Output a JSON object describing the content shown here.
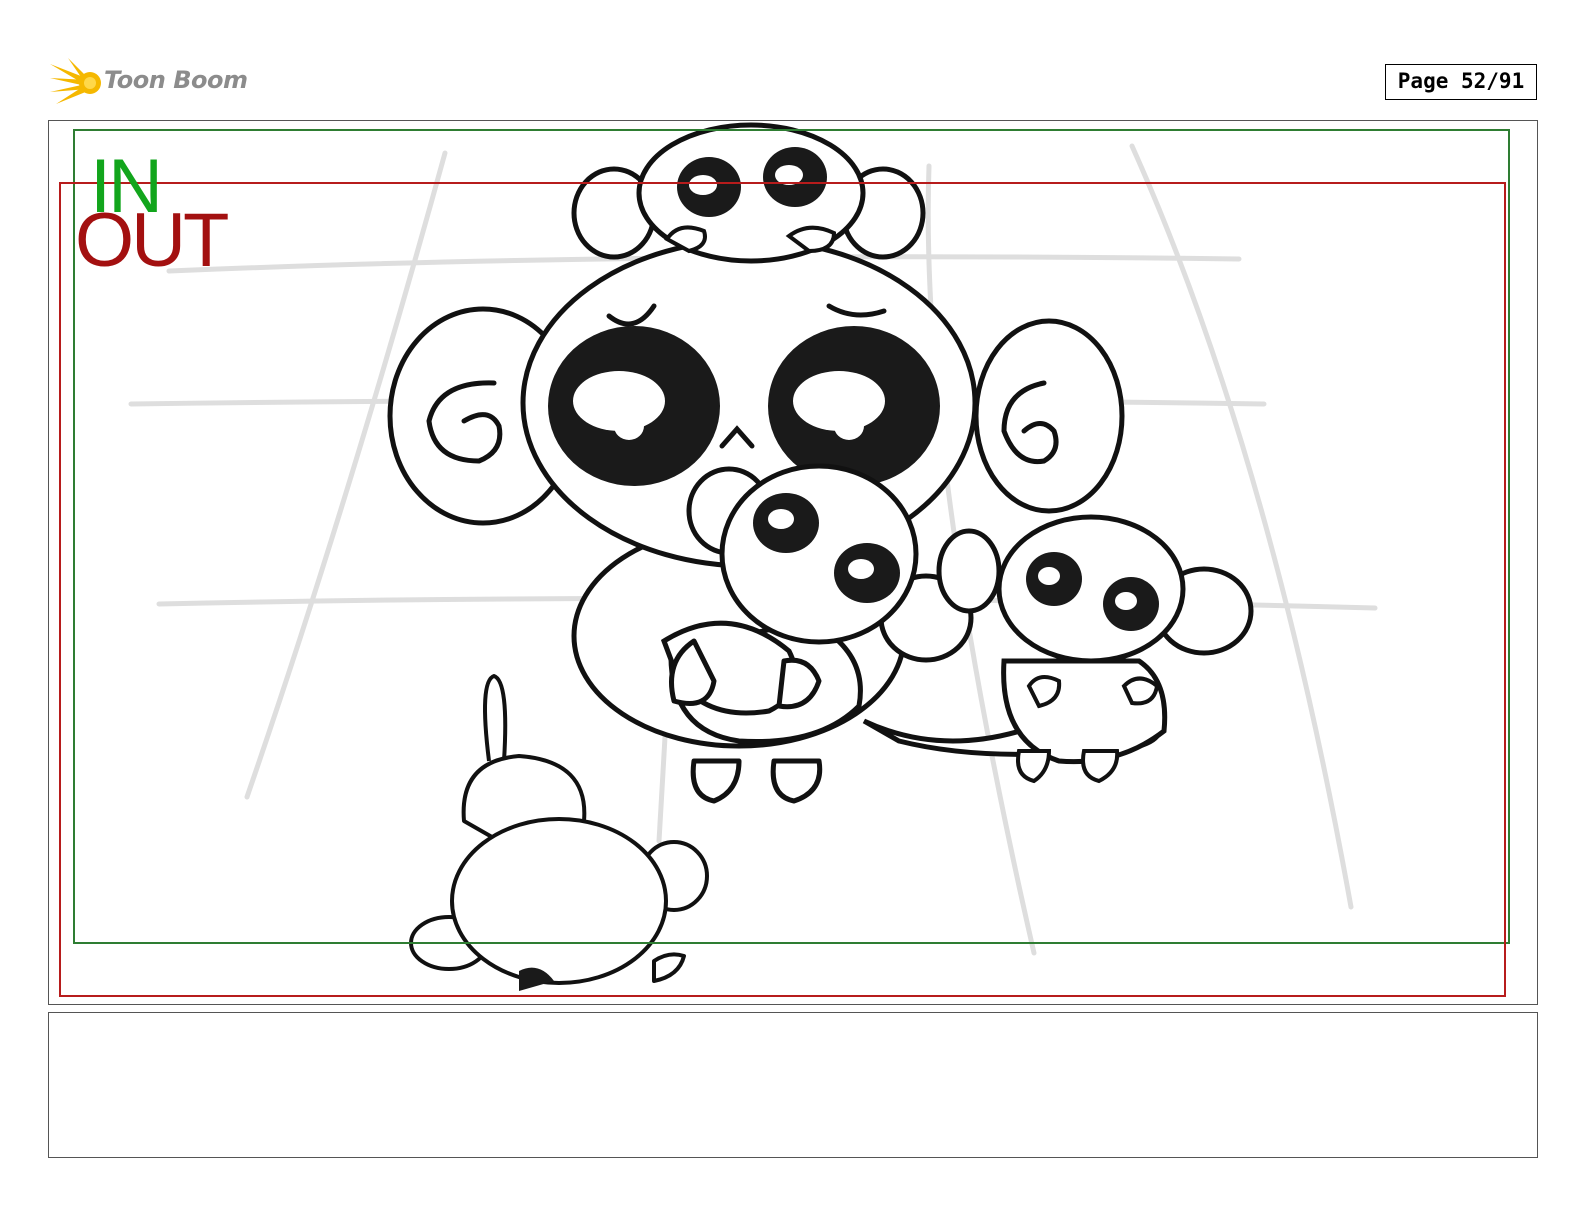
{
  "header": {
    "logo_text": "Toon Boom",
    "logo_colors": {
      "burst": "#f5b800",
      "text": "#8c8c8c"
    },
    "page_label": "Page 52/91"
  },
  "panel": {
    "in_label": "IN",
    "out_label": "OUT",
    "frame_colors": {
      "in": "#2e7d32",
      "out": "#b71c1c",
      "in_text": "#12a51c",
      "out_text": "#a31010"
    },
    "drawing": "monkey family sketch"
  },
  "notes": {
    "text": ""
  }
}
